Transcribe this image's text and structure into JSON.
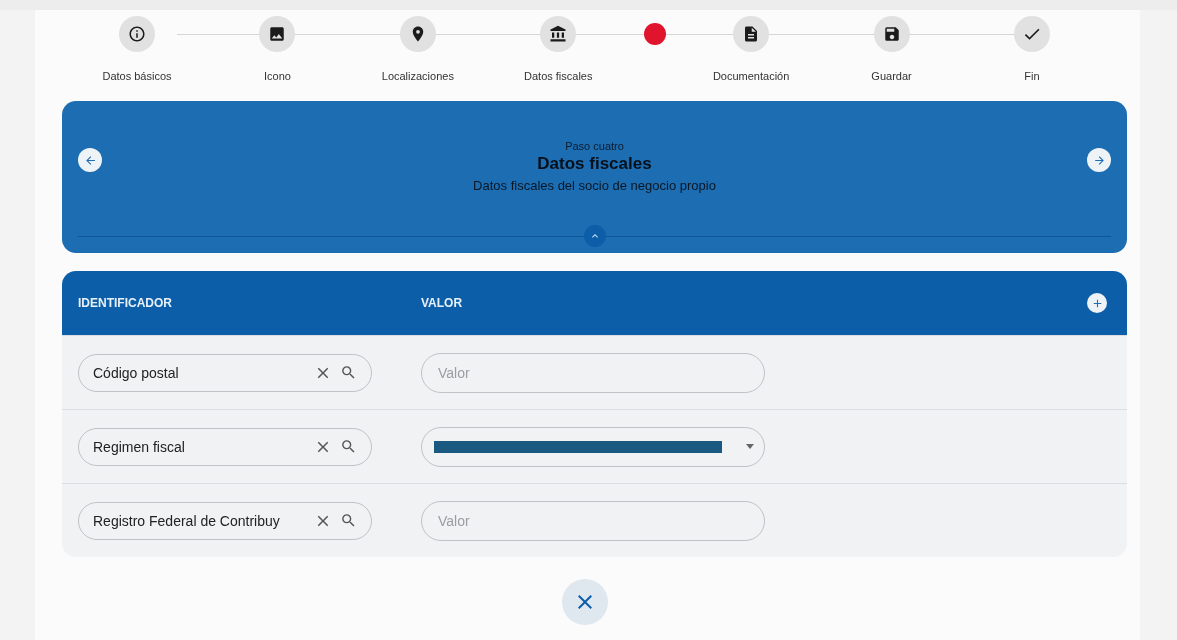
{
  "stepper": {
    "steps": [
      {
        "kind": "step",
        "label": "Datos básicos"
      },
      {
        "kind": "step",
        "label": "Icono"
      },
      {
        "kind": "step",
        "label": "Localizaciones"
      },
      {
        "kind": "step",
        "label": "Datos fiscales"
      },
      {
        "kind": "marker",
        "color": "#e0142c"
      },
      {
        "kind": "step",
        "label": "Documentación"
      },
      {
        "kind": "step",
        "label": "Guardar"
      },
      {
        "kind": "step",
        "label": "Fin"
      }
    ]
  },
  "banner": {
    "overline": "Paso cuatro",
    "title": "Datos fiscales",
    "description": "Datos fiscales del socio de negocio propio"
  },
  "table": {
    "columns": [
      "IDENTIFICADOR",
      "VALOR"
    ],
    "rows": [
      {
        "identifier": "Código postal",
        "value": {
          "kind": "input",
          "placeholder": "Valor"
        }
      },
      {
        "identifier": "Regimen fiscal",
        "value": {
          "kind": "redacted-select"
        }
      },
      {
        "identifier": "Registro Federal de Contribuy",
        "value": {
          "kind": "input",
          "placeholder": "Valor"
        }
      }
    ]
  }
}
